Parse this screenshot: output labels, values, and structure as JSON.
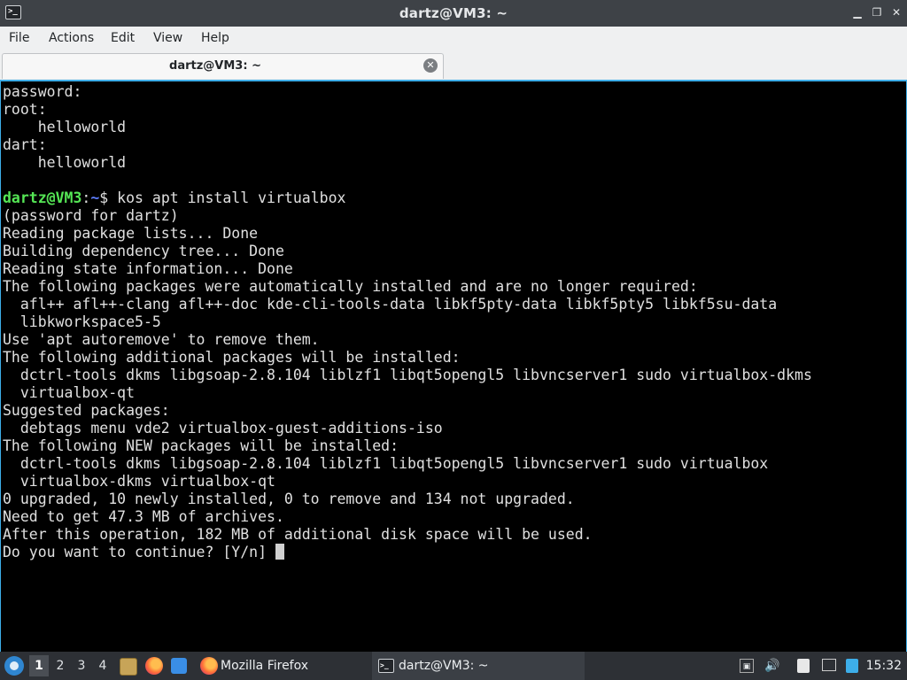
{
  "window": {
    "title": "dartz@VM3: ~",
    "app_icon": ">_",
    "controls": {
      "minimize": "▁",
      "restore": "❐",
      "close": "✕"
    }
  },
  "menu": {
    "file": "File",
    "actions": "Actions",
    "edit": "Edit",
    "view": "View",
    "help": "Help"
  },
  "tab": {
    "label": "dartz@VM3: ~",
    "close": "✕"
  },
  "terminal": {
    "lines": [
      "password:",
      "root:",
      "    helloworld",
      "dart:",
      "    helloworld",
      "",
      "",
      "(password for dartz)",
      "Reading package lists... Done",
      "Building dependency tree... Done",
      "Reading state information... Done",
      "The following packages were automatically installed and are no longer required:",
      "  afl++ afl++-clang afl++-doc kde-cli-tools-data libkf5pty-data libkf5pty5 libkf5su-data",
      "  libkworkspace5-5",
      "Use 'apt autoremove' to remove them.",
      "The following additional packages will be installed:",
      "  dctrl-tools dkms libgsoap-2.8.104 liblzf1 libqt5opengl5 libvncserver1 sudo virtualbox-dkms",
      "  virtualbox-qt",
      "Suggested packages:",
      "  debtags menu vde2 virtualbox-guest-additions-iso",
      "The following NEW packages will be installed:",
      "  dctrl-tools dkms libgsoap-2.8.104 liblzf1 libqt5opengl5 libvncserver1 sudo virtualbox",
      "  virtualbox-dkms virtualbox-qt",
      "0 upgraded, 10 newly installed, 0 to remove and 134 not upgraded.",
      "Need to get 47.3 MB of archives.",
      "After this operation, 182 MB of additional disk space will be used.",
      "Do you want to continue? [Y/n] "
    ],
    "prompt": {
      "user_host": "dartz@VM3",
      "sep": ":",
      "path": "~",
      "symbol": "$ ",
      "command": "kos apt install virtualbox"
    }
  },
  "taskbar": {
    "desktops": [
      "1",
      "2",
      "3",
      "4"
    ],
    "firefox_task": "Mozilla Firefox",
    "terminal_task": "dartz@VM3: ~",
    "clock": "15:32"
  },
  "colors": {
    "prompt_user": "#55e655",
    "prompt_path": "#5c7cfa",
    "focus_border": "#3daee9"
  }
}
